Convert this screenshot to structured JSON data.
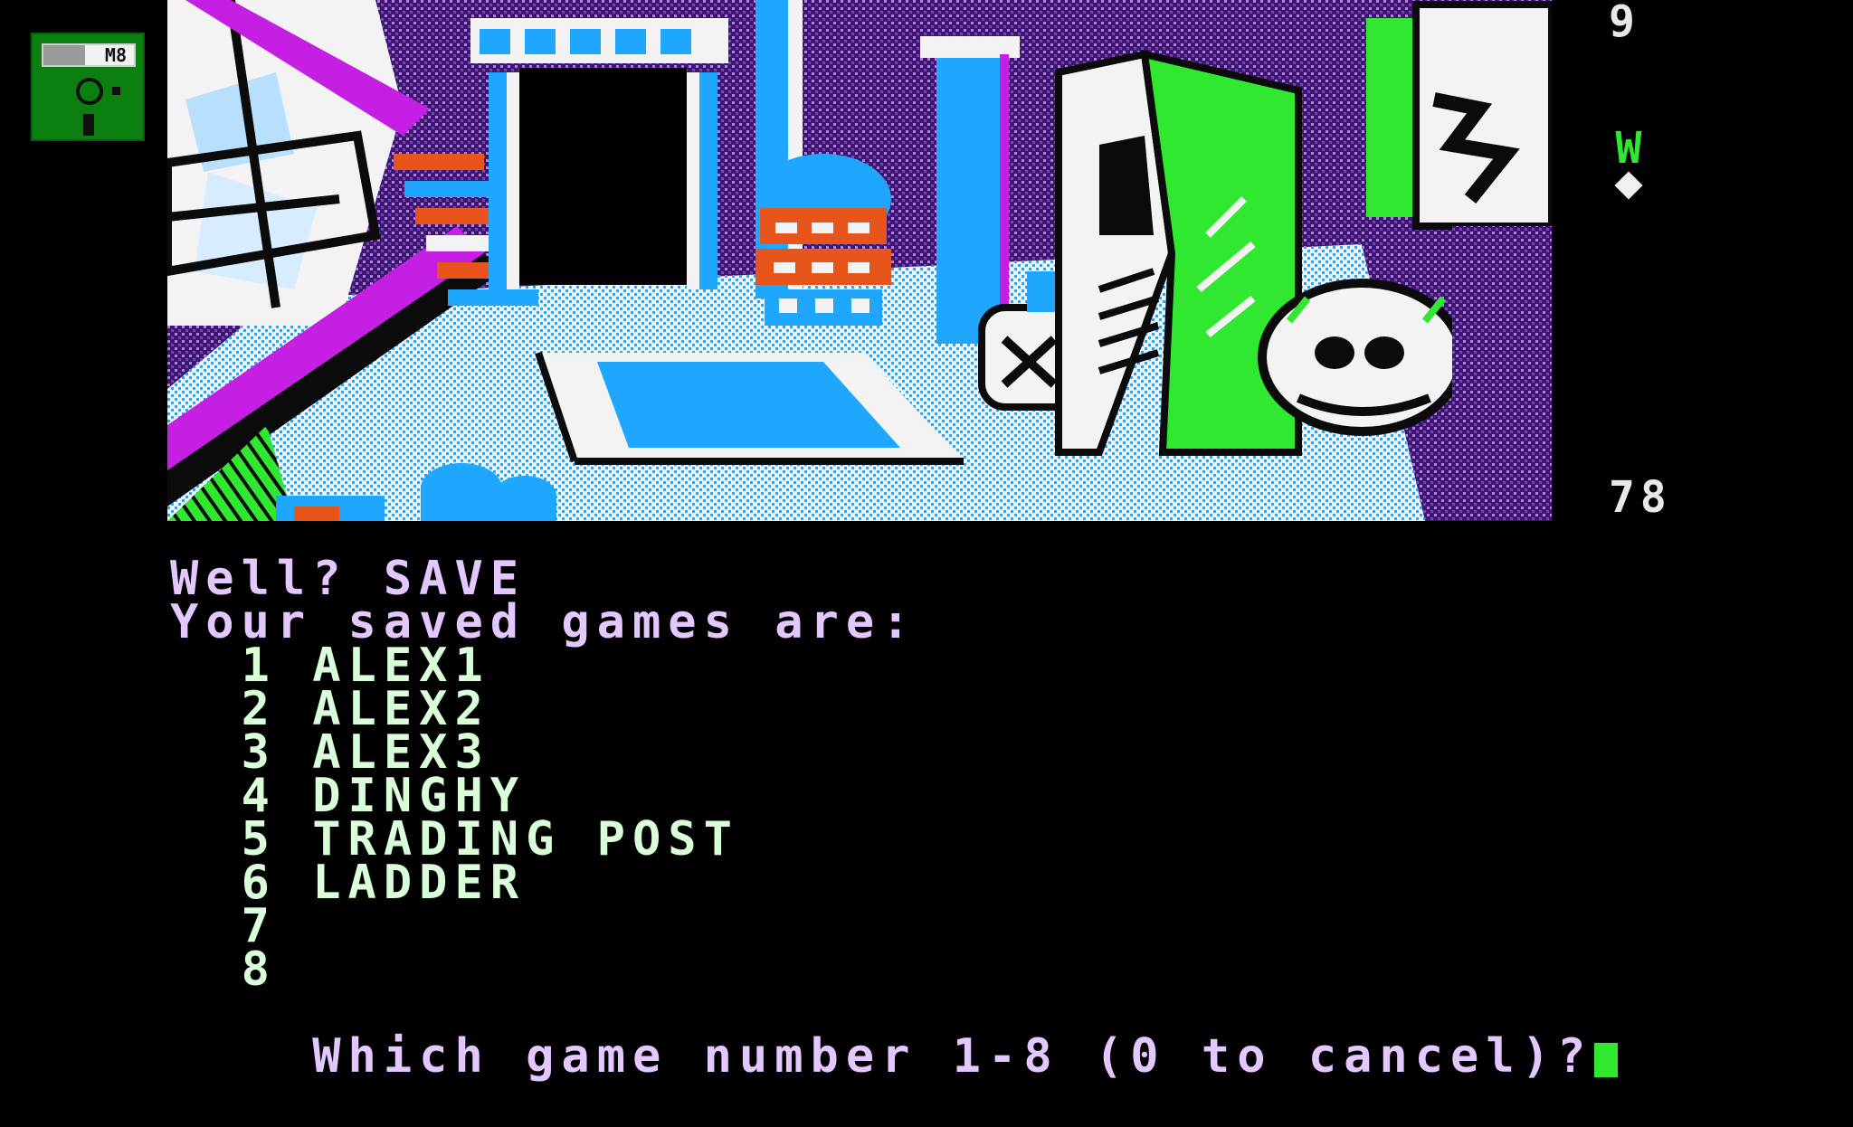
{
  "disk": {
    "label": "M8",
    "icon": "floppy-disk-icon",
    "color": "#0b7f10"
  },
  "status": {
    "top_number": "9",
    "compass_letter": "W",
    "bottom_number": "78"
  },
  "console": {
    "lines": [
      "Well? SAVE",
      "Your saved games are:",
      "  1 ALEX1",
      "  2 ALEX2",
      "  3 ALEX3",
      "  4 DINGHY",
      "  5 TRADING POST",
      "  6 LADDER",
      "  7",
      "  8",
      "Which game number 1-8 (0 to cancel)?"
    ]
  },
  "colors": {
    "text_purple": "#e3c8ff",
    "text_green": "#d9ffd9",
    "accent_green": "#2fe82f",
    "accent_blue": "#1fa6ff",
    "accent_orange": "#e8551c",
    "accent_magenta": "#c41fe3"
  }
}
